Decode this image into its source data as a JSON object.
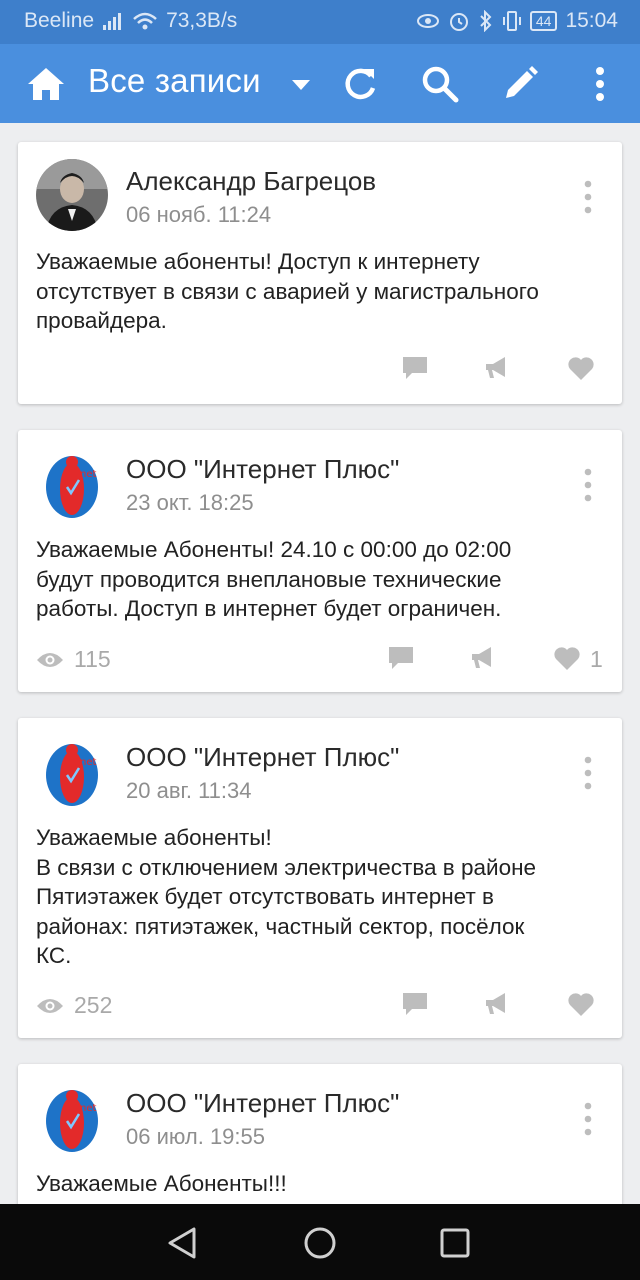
{
  "status_bar": {
    "carrier": "Beeline",
    "speed": "73,3B/s",
    "battery": "44",
    "time": "15:04"
  },
  "toolbar": {
    "title": "Все записи",
    "icons": [
      "home-icon",
      "dropdown-icon",
      "refresh-icon",
      "search-icon",
      "edit-icon",
      "more-icon"
    ]
  },
  "posts": [
    {
      "author": "Александр Багрецов",
      "date": "06 нояб. 11:24",
      "text_lines": [
        "Уважаемые абоненты! Доступ к интернету",
        "отсутствует в связи с аварией у магистрального",
        "провайдера."
      ],
      "views": "",
      "likes": ""
    },
    {
      "author": "ООО \"Интернет Плюс\"",
      "date": "23 окт. 18:25",
      "text_lines": [
        "Уважаемые Абоненты! 24.10 с 00:00 до 02:00",
        "будут проводится внеплановые технические",
        "работы. Доступ в интернет будет ограничен."
      ],
      "views": "115",
      "likes": "1"
    },
    {
      "author": "ООО \"Интернет Плюс\"",
      "date": "20 авг. 11:34",
      "text_lines": [
        "Уважаемые абоненты!",
        "В связи с отключением электричества в районе",
        "Пятиэтажек будет отсутствовать интернет в",
        "районах: пятиэтажек, частный сектор, посёлок",
        "КС."
      ],
      "views": "252",
      "likes": ""
    },
    {
      "author": "ООО \"Интернет Плюс\"",
      "date": "06 июл. 19:55",
      "text_lines": [
        "Уважаемые Абоненты!!!"
      ],
      "views": "",
      "likes": ""
    }
  ],
  "colors": {
    "toolbar": "#4a8fde",
    "statusbar": "#3e7fcb",
    "background": "#edeef0",
    "icon_gray": "#b9b9b9"
  }
}
